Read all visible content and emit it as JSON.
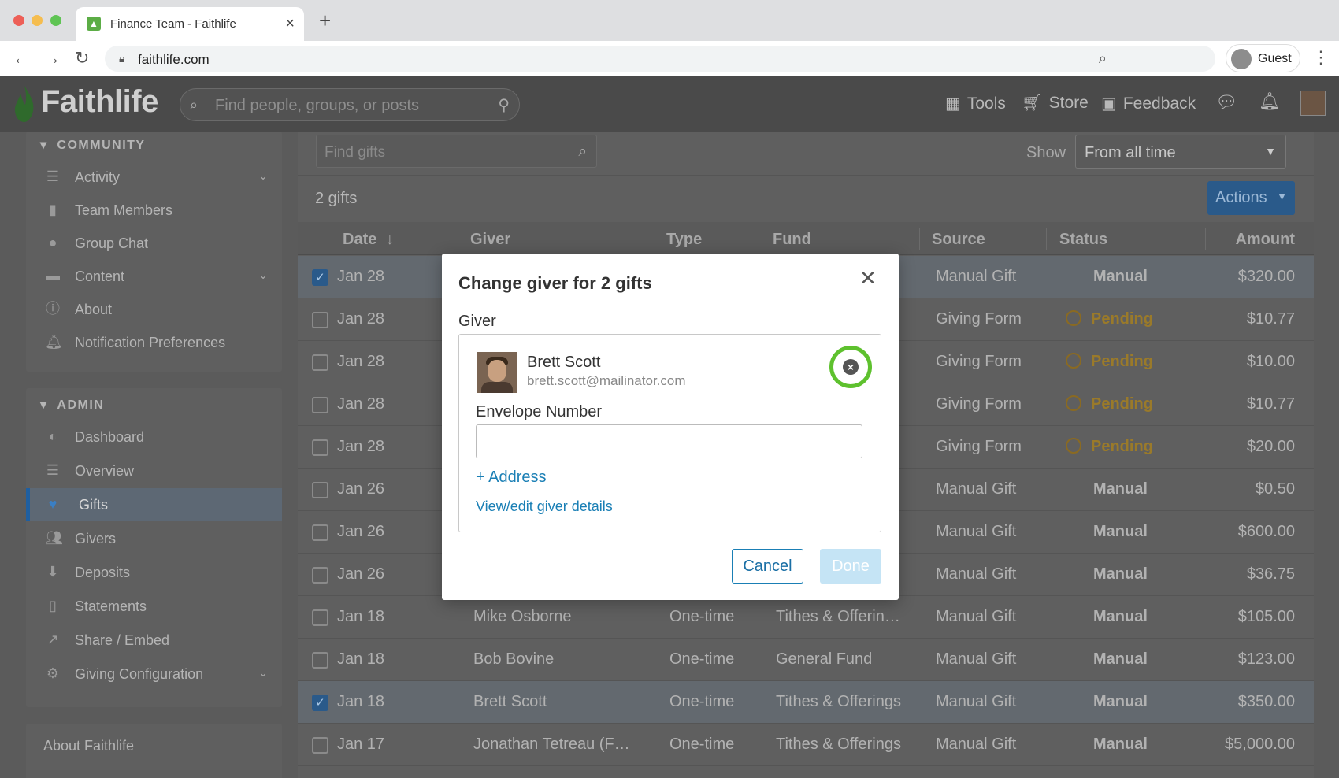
{
  "browser": {
    "tab_title": "Finance Team - Faithlife",
    "url": "faithlife.com",
    "profile": "Guest"
  },
  "header": {
    "logo": "Faithlife",
    "search_placeholder": "Find people, groups, or posts",
    "nav": {
      "tools": "Tools",
      "store": "Store",
      "feedback": "Feedback"
    }
  },
  "sidebar": {
    "community_heading": "COMMUNITY",
    "community_items": [
      {
        "label": "Activity",
        "icon": "activity-icon",
        "expandable": true
      },
      {
        "label": "Team Members",
        "icon": "members-icon"
      },
      {
        "label": "Group Chat",
        "icon": "chat-icon"
      },
      {
        "label": "Content",
        "icon": "folder-icon",
        "expandable": true
      },
      {
        "label": "About",
        "icon": "info-icon"
      },
      {
        "label": "Notification Preferences",
        "icon": "bell-icon"
      }
    ],
    "admin_heading": "ADMIN",
    "admin_items": [
      {
        "label": "Dashboard",
        "icon": "dashboard-icon"
      },
      {
        "label": "Overview",
        "icon": "overview-icon"
      },
      {
        "label": "Gifts",
        "icon": "heart-icon",
        "active": true
      },
      {
        "label": "Givers",
        "icon": "people-icon"
      },
      {
        "label": "Deposits",
        "icon": "deposit-icon"
      },
      {
        "label": "Statements",
        "icon": "document-icon"
      },
      {
        "label": "Share / Embed",
        "icon": "share-icon"
      },
      {
        "label": "Giving Configuration",
        "icon": "gear-icon",
        "expandable": true
      }
    ],
    "footer_link": "About Faithlife"
  },
  "main": {
    "find_placeholder": "Find gifts",
    "show_label": "Show",
    "show_value": "From all time",
    "gift_count": "2 gifts",
    "actions_label": "Actions",
    "columns": {
      "date": "Date",
      "giver": "Giver",
      "type": "Type",
      "fund": "Fund",
      "source": "Source",
      "status": "Status",
      "amount": "Amount"
    },
    "rows": [
      {
        "checked": true,
        "date": "Jan 28",
        "giver": "",
        "type": "",
        "fund": "",
        "source": "Manual Gift",
        "status": "Manual",
        "amount": "$320.00"
      },
      {
        "checked": false,
        "date": "Jan 28",
        "giver": "",
        "type": "",
        "fund": "",
        "source": "Giving Form",
        "status": "Pending",
        "amount": "$10.77"
      },
      {
        "checked": false,
        "date": "Jan 28",
        "giver": "",
        "type": "",
        "fund": "",
        "source": "Giving Form",
        "status": "Pending",
        "amount": "$10.00"
      },
      {
        "checked": false,
        "date": "Jan 28",
        "giver": "",
        "type": "",
        "fund": "",
        "source": "Giving Form",
        "status": "Pending",
        "amount": "$10.77"
      },
      {
        "checked": false,
        "date": "Jan 28",
        "giver": "",
        "type": "",
        "fund": "",
        "source": "Giving Form",
        "status": "Pending",
        "amount": "$20.00"
      },
      {
        "checked": false,
        "date": "Jan 26",
        "giver": "",
        "type": "",
        "fund": "",
        "source": "Manual Gift",
        "status": "Manual",
        "amount": "$0.50"
      },
      {
        "checked": false,
        "date": "Jan 26",
        "giver": "",
        "type": "",
        "fund": "",
        "source": "Manual Gift",
        "status": "Manual",
        "amount": "$600.00"
      },
      {
        "checked": false,
        "date": "Jan 26",
        "giver": "",
        "type": "",
        "fund": "",
        "source": "Manual Gift",
        "status": "Manual",
        "amount": "$36.75"
      },
      {
        "checked": false,
        "date": "Jan 18",
        "giver": "Mike Osborne",
        "type": "One-time",
        "fund": "Tithes & Offerin…",
        "source": "Manual Gift",
        "status": "Manual",
        "amount": "$105.00"
      },
      {
        "checked": false,
        "date": "Jan 18",
        "giver": "Bob Bovine",
        "type": "One-time",
        "fund": "General Fund",
        "source": "Manual Gift",
        "status": "Manual",
        "amount": "$123.00"
      },
      {
        "checked": true,
        "date": "Jan 18",
        "giver": "Brett Scott",
        "type": "One-time",
        "fund": "Tithes & Offerings",
        "source": "Manual Gift",
        "status": "Manual",
        "amount": "$350.00"
      },
      {
        "checked": false,
        "date": "Jan 17",
        "giver": "Jonathan Tetreau (F…",
        "type": "One-time",
        "fund": "Tithes & Offerings",
        "source": "Manual Gift",
        "status": "Manual",
        "amount": "$5,000.00"
      }
    ]
  },
  "modal": {
    "title": "Change giver for 2 gifts",
    "giver_label": "Giver",
    "giver_name": "Brett Scott",
    "giver_email": "brett.scott@mailinator.com",
    "envelope_label": "Envelope Number",
    "envelope_value": "",
    "address_link": "+ Address",
    "view_link": "View/edit giver details",
    "cancel": "Cancel",
    "done": "Done"
  },
  "colors": {
    "accent": "#1a7fb5",
    "highlight": "#5ec12e",
    "pending": "#d49a2a"
  }
}
